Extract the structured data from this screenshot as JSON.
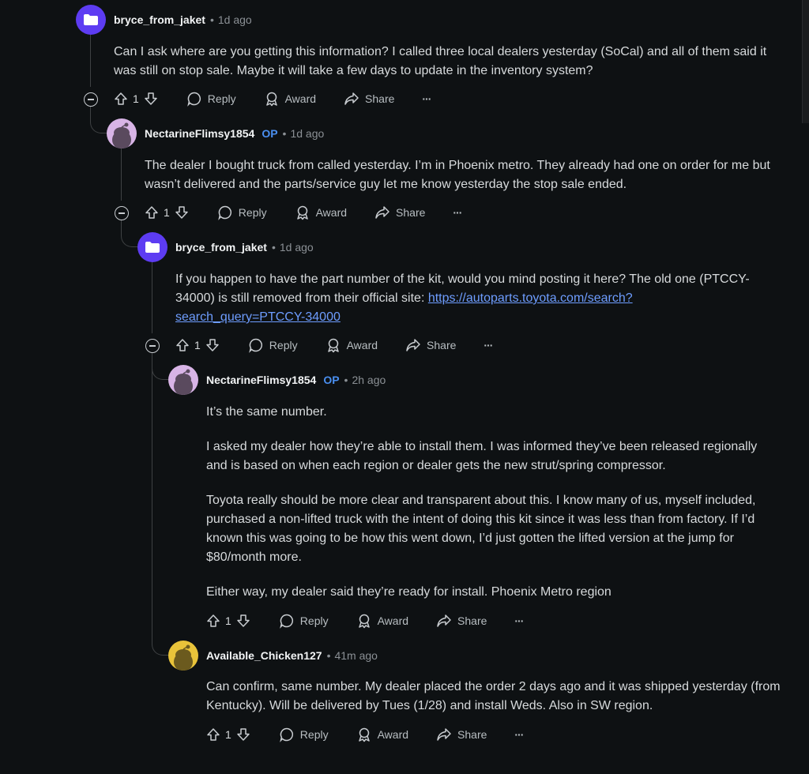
{
  "comments": [
    {
      "author": "bryce_from_jaket",
      "op": "",
      "time": "1d ago",
      "avatar": "folder-avatar",
      "body": [
        "Can I ask where are you getting this information? I called three local dealers yesterday (SoCal) and all of them said it was still on stop sale. Maybe it will take a few days to update in the inventory system?"
      ],
      "score": "1"
    },
    {
      "author": "NectarineFlimsy1854",
      "op": "OP",
      "time": "1d ago",
      "avatar": "snoo-avatar",
      "body": [
        "The dealer I bought truck from called yesterday. I’m in Phoenix metro. They already had one on order for me but wasn’t delivered and the parts/service guy let me know yesterday the stop sale ended."
      ],
      "score": "1"
    },
    {
      "author": "bryce_from_jaket",
      "op": "",
      "time": "1d ago",
      "avatar": "folder-avatar",
      "body_prefix": "If you happen to have the part number of the kit, would you mind posting it here? The old one (PTCCY-34000) is still removed from their official site: ",
      "link_text": "https://autoparts.toyota.com/search?search_query=PTCCY-34000",
      "score": "1"
    },
    {
      "author": "NectarineFlimsy1854",
      "op": "OP",
      "time": "2h ago",
      "avatar": "snoo-avatar",
      "body": [
        "It’s the same number.",
        "I asked my dealer how they’re able to install them. I was informed they’ve been released regionally and is based on when each region or dealer gets the new strut/spring compressor.",
        "Toyota really should be more clear and transparent about this. I know many of us, myself included, purchased a non-lifted truck with the intent of doing this kit since it was less than from factory. If I’d known this was going to be how this went down, I’d just gotten the lifted version at the jump for $80/month more.",
        "Either way, my dealer said they’re ready for install. Phoenix Metro region"
      ],
      "score": "1"
    },
    {
      "author": "Available_Chicken127",
      "op": "",
      "time": "41m ago",
      "avatar": "snoo-avatar",
      "body": [
        "Can confirm, same number. My dealer placed the order 2 days ago and it was shipped yesterday (from Kentucky). Will be delivered by Tues (1/28) and install Weds. Also in SW region."
      ],
      "score": "1"
    }
  ],
  "actions": {
    "reply": "Reply",
    "award": "Award",
    "share": "Share",
    "more": "···"
  },
  "dot": "•",
  "colors": {
    "background": "#0e1113",
    "accent_op": "#4a8ff0",
    "link": "#6e9dff",
    "avatar_purple": "#5d3cf2",
    "avatar_pink": "#d8b4e6",
    "avatar_yellow": "#e8c33a"
  }
}
